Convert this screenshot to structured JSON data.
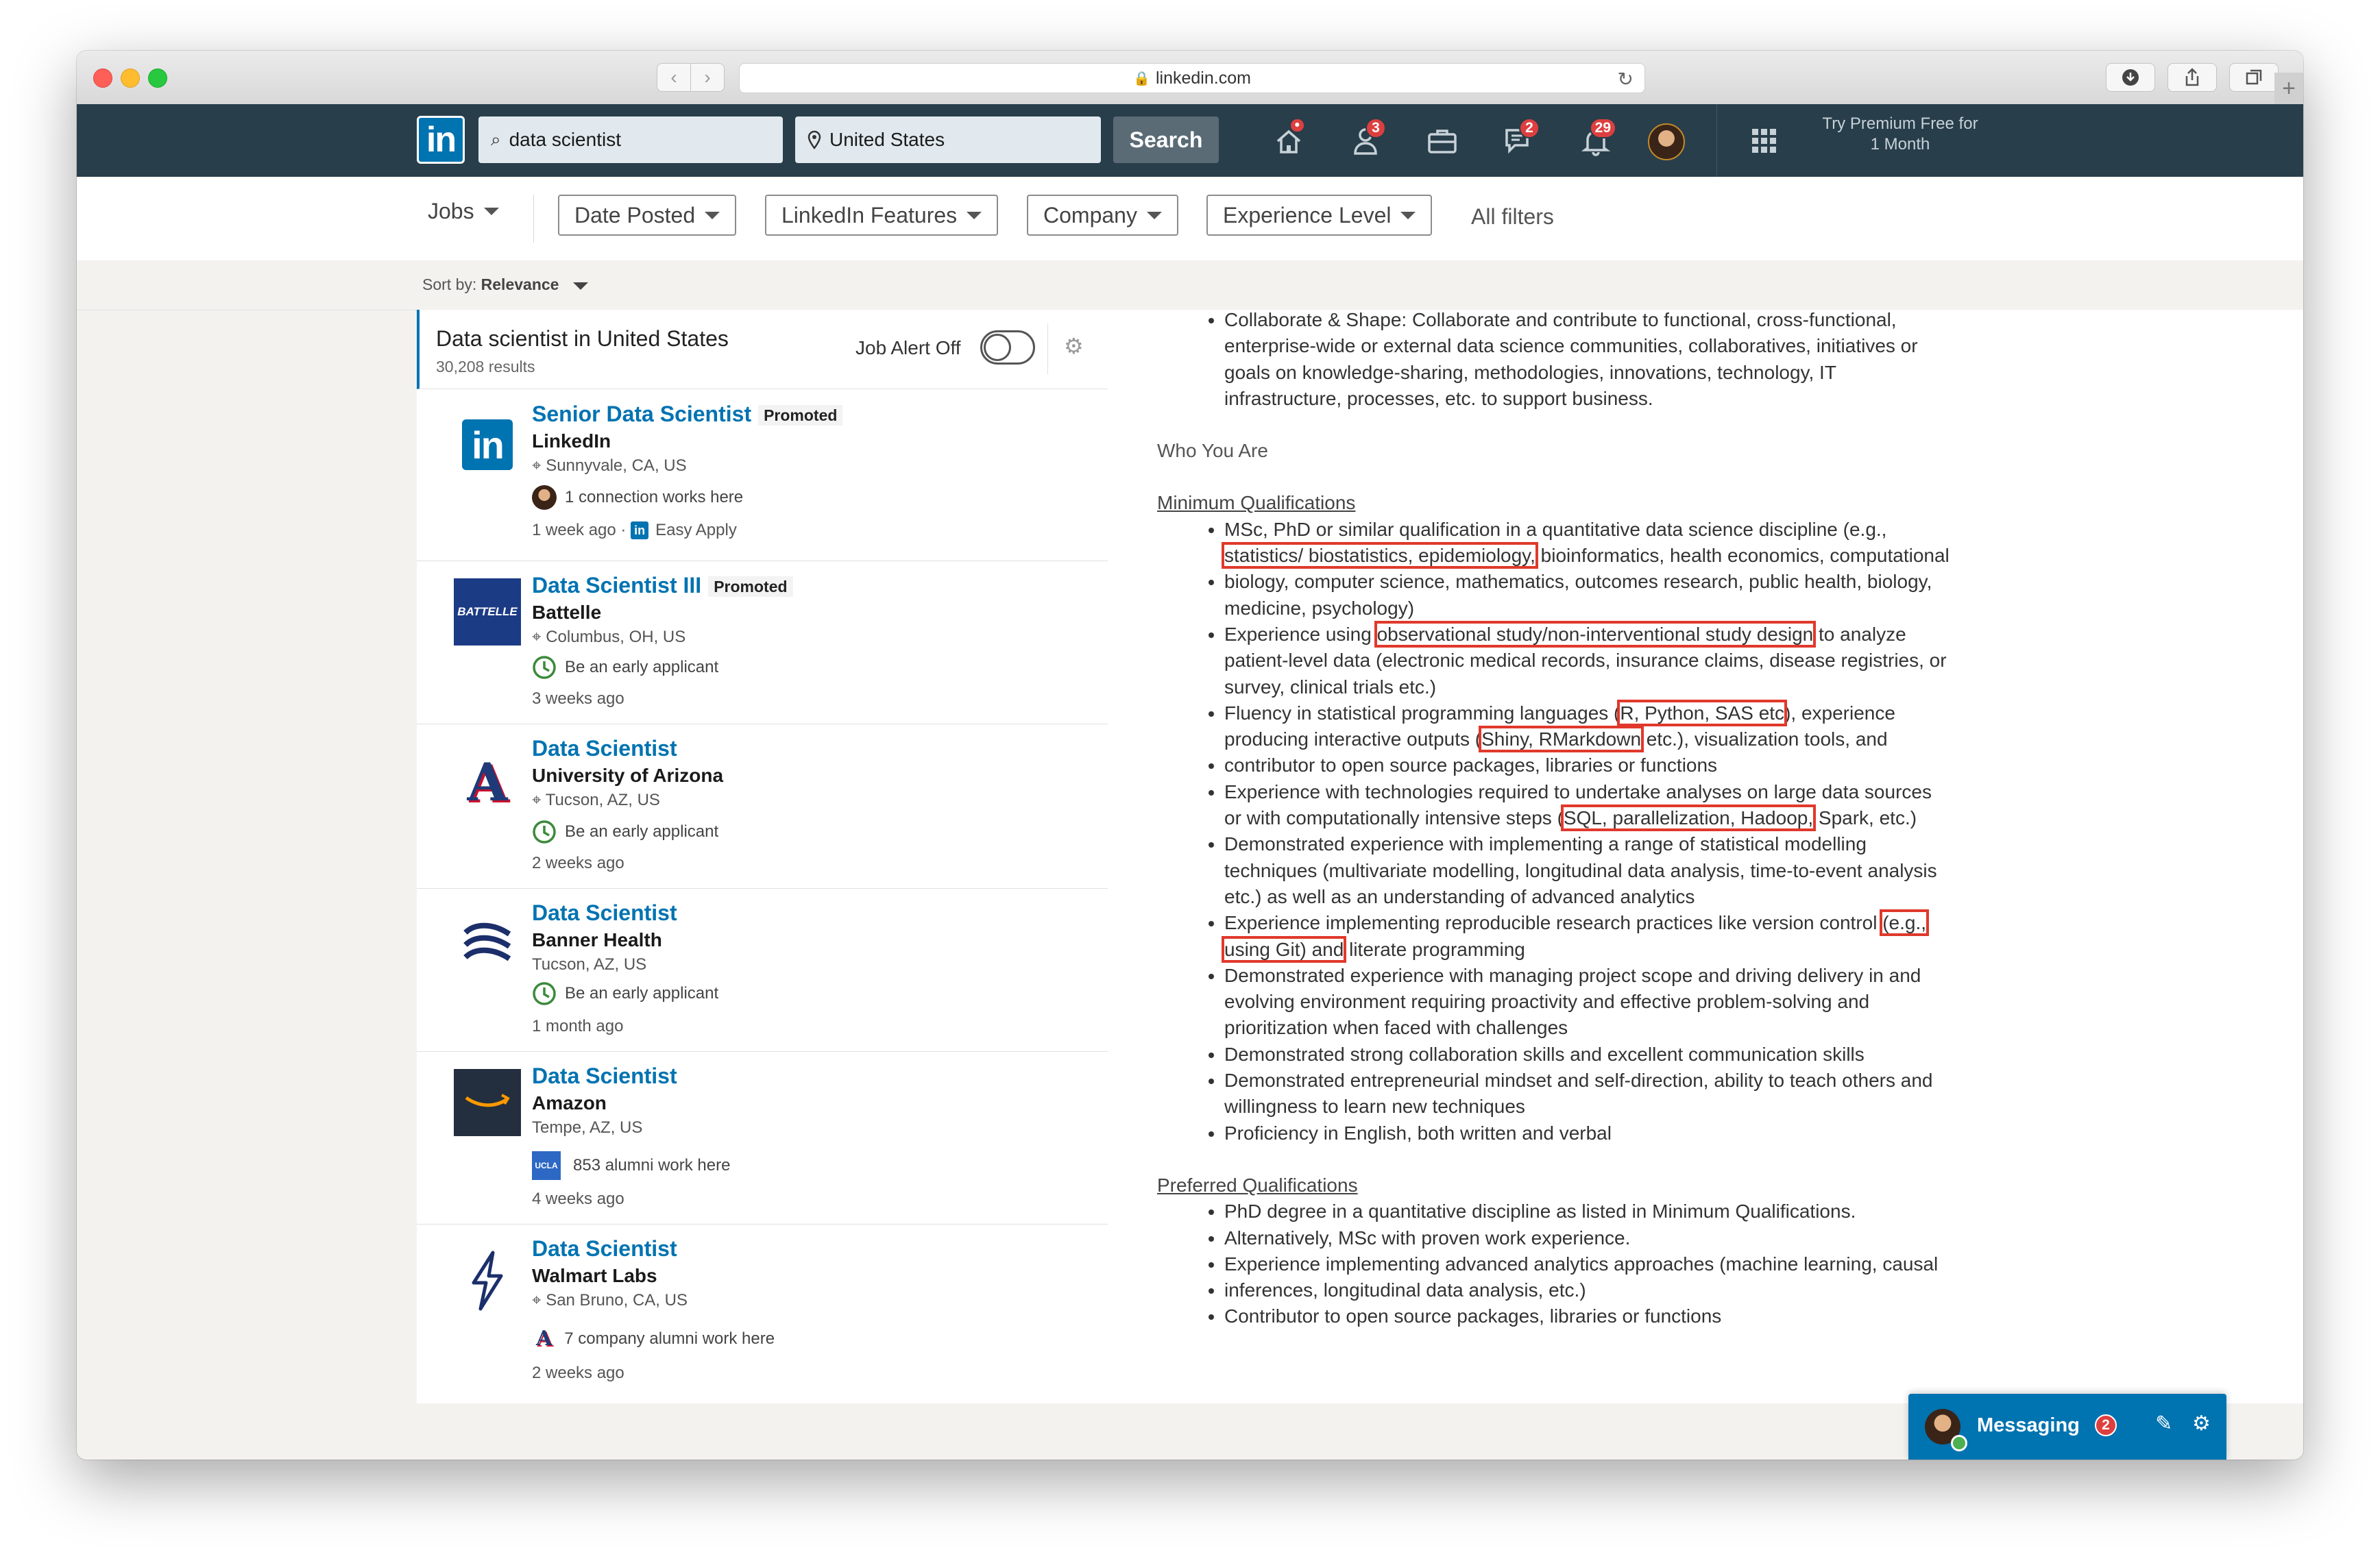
{
  "browser": {
    "url": "linkedin.com",
    "back": "‹",
    "forward": "›"
  },
  "nav": {
    "logo": "in",
    "keyword": "data scientist",
    "location": "United States",
    "search_label": "Search",
    "badges": {
      "home": "•",
      "network": "3",
      "messaging": "2",
      "notifications": "29"
    },
    "premium": "Try Premium Free for 1 Month"
  },
  "filters": {
    "jobs": "Jobs",
    "date_posted": "Date Posted",
    "linkedin_features": "LinkedIn Features",
    "company": "Company",
    "experience_level": "Experience Level",
    "all_filters": "All filters"
  },
  "sort": {
    "label": "Sort by:",
    "value": "Relevance"
  },
  "list": {
    "title": "Data scientist in United States",
    "count": "30,208 results",
    "alert_label": "Job Alert Off",
    "jobs": [
      {
        "title": "Senior Data Scientist",
        "promoted": "Promoted",
        "company": "LinkedIn",
        "location": "Sunnyvale, CA, US",
        "insight": "1 connection works here",
        "posted": "1 week ago",
        "easy_apply": "Easy Apply"
      },
      {
        "title": "Data Scientist III",
        "promoted": "Promoted",
        "company": "Battelle",
        "location": "Columbus, OH, US",
        "insight": "Be an early applicant",
        "posted": "3 weeks ago",
        "logo_text": "BATTELLE"
      },
      {
        "title": "Data Scientist",
        "company": "University of Arizona",
        "location": "Tucson, AZ, US",
        "insight": "Be an early applicant",
        "posted": "2 weeks ago",
        "logo_text": "A"
      },
      {
        "title": "Data Scientist",
        "company": "Banner Health",
        "location": "Tucson, AZ, US",
        "insight": "Be an early applicant",
        "posted": "1 month ago"
      },
      {
        "title": "Data Scientist",
        "company": "Amazon",
        "location": "Tempe, AZ, US",
        "insight": "853 alumni work here",
        "insight_logo": "UCLA",
        "posted": "4 weeks ago"
      },
      {
        "title": "Data Scientist",
        "company": "Walmart Labs",
        "location": "San Bruno, CA, US",
        "insight": "7 company alumni work here",
        "posted": "2 weeks ago"
      }
    ]
  },
  "description": {
    "collab": "Collaborate & Shape: Collaborate and contribute to functional, cross-functional, enterprise-wide or external data science communities, collaboratives, initiatives or goals on knowledge-sharing, methodologies, innovations, technology, IT infrastructure, processes, etc. to support business.",
    "who": "Who You Are",
    "min_head": "Minimum Qualifications",
    "min": {
      "q1a": "MSc, PhD or similar qualification in a quantitative data science discipline (e.g.,",
      "q1hl": "statistics/ biostatistics, epidemiology,",
      "q1b": "bioinformatics, health economics, computational",
      "q2": "biology, computer science, mathematics, outcomes research, public health, biology, medicine, psychology)",
      "q3a": "Experience using",
      "q3hl": "observational study/non-interventional study design",
      "q3b": "to analyze patient-level data (electronic medical records, insurance claims, disease registries, or survey, clinical trials etc.)",
      "q4a": "Fluency in statistical programming languages (",
      "q4hl": "R, Python, SAS etc",
      "q4b": "), experience producing interactive outputs (",
      "q4hl2": "Shiny, RMarkdown",
      "q4c": "etc.), visualization tools, and",
      "q5": "contributor to open source packages, libraries or functions",
      "q6a": "Experience with technologies required to undertake analyses on large data sources or with computationally intensive steps (",
      "q6hl": "SQL, parallelization, Hadoop,",
      "q6b": "Spark, etc.)",
      "q7": "Demonstrated experience with implementing a range of statistical modelling techniques (multivariate modelling, longitudinal data analysis, time-to-event analysis etc.) as well as an understanding of advanced analytics",
      "q8a": "Experience implementing reproducible research practices like version control",
      "q8hl": "(e.g., using Git) and",
      "q8b": "literate programming",
      "q9": "Demonstrated experience with managing project scope and driving delivery in and evolving environment requiring proactivity and effective problem-solving and prioritization when faced with challenges",
      "q10": "Demonstrated strong collaboration skills and excellent communication skills",
      "q11": "Demonstrated entrepreneurial mindset and self-direction, ability to teach others and willingness to learn new techniques",
      "q12": "Proficiency in English, both written and verbal"
    },
    "pref_head": "Preferred Qualifications",
    "pref": {
      "p1": "PhD degree in a quantitative discipline as listed in Minimum Qualifications.",
      "p2": "Alternatively, MSc with proven work experience.",
      "p3": "Experience implementing advanced analytics approaches (machine learning, causal",
      "p4": "inferences, longitudinal data analysis, etc.)",
      "p5": "Contributor to open source packages, libraries or functions"
    }
  },
  "messaging": {
    "label": "Messaging",
    "count": "2"
  },
  "colors": {
    "linkedin_blue": "#0073b1",
    "nav_bg": "#283e4a",
    "highlight_red": "#e0392b"
  }
}
